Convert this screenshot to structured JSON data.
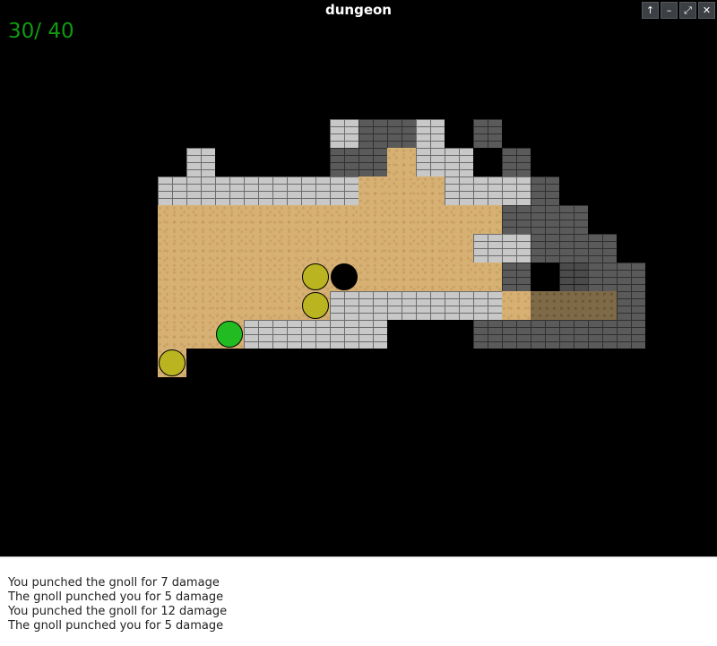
{
  "window": {
    "title": "dungeon"
  },
  "window_controls": [
    "↑",
    "–",
    "⤢",
    "✕"
  ],
  "hud": {
    "hp": "30/ 40"
  },
  "entities": [
    {
      "type": "player",
      "color": "#22bb22"
    },
    {
      "type": "gnoll",
      "color": "#b9b420"
    },
    {
      "type": "gnoll",
      "color": "#b9b420"
    },
    {
      "type": "gnoll",
      "color": "#b9b420"
    },
    {
      "type": "hole",
      "color": "#000000"
    }
  ],
  "log": [
    "You punched the gnoll for 7 damage",
    "The gnoll punched you for 5 damage",
    "You punched the gnoll for 12 damage",
    "The gnoll punched you for 5 damage"
  ]
}
